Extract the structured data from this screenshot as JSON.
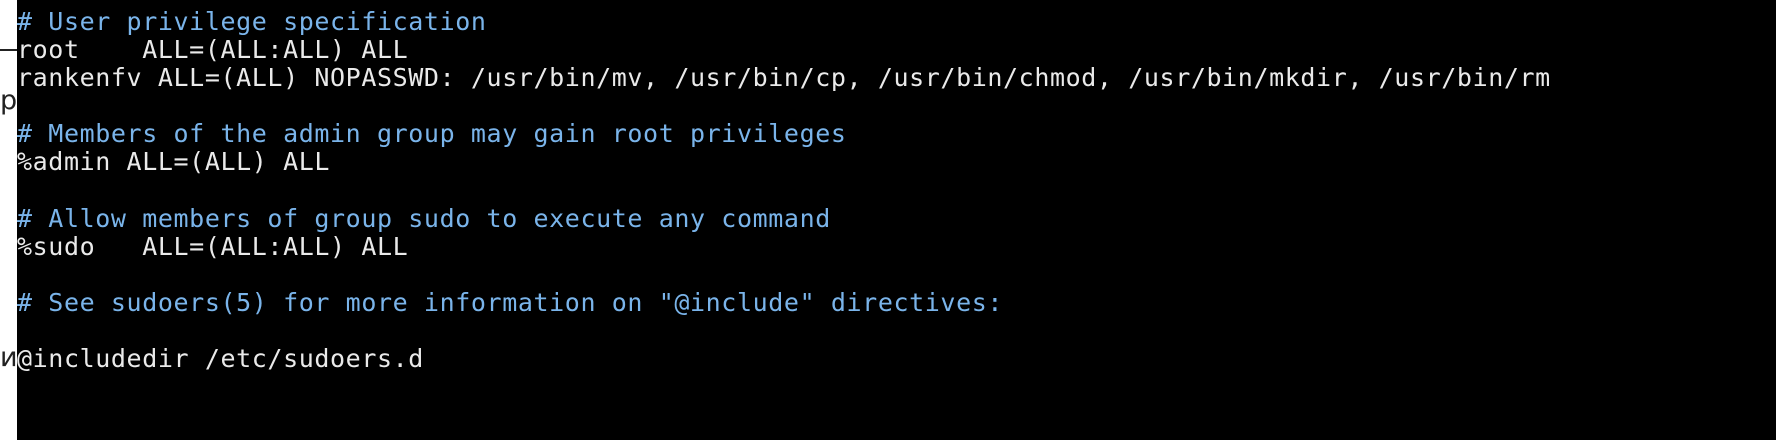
{
  "theme": {
    "background": "#000000",
    "comment_color": "#7ab4ea",
    "text_color": "#eaeaea"
  },
  "left_fragments": [
    "ре",
    "и"
  ],
  "lines": [
    {
      "type": "comment",
      "text": "# User privilege specification"
    },
    {
      "type": "code",
      "text": "root    ALL=(ALL:ALL) ALL"
    },
    {
      "type": "code",
      "text": "rankenfv ALL=(ALL) NOPASSWD: /usr/bin/mv, /usr/bin/cp, /usr/bin/chmod, /usr/bin/mkdir, /usr/bin/rm"
    },
    {
      "type": "comment",
      "text": "# Members of the admin group may gain root privileges"
    },
    {
      "type": "code",
      "text": "%admin ALL=(ALL) ALL"
    },
    {
      "type": "comment",
      "text": "# Allow members of group sudo to execute any command"
    },
    {
      "type": "code",
      "text": "%sudo   ALL=(ALL:ALL) ALL"
    },
    {
      "type": "comment",
      "text": "# See sudoers(5) for more information on \"@include\" directives:"
    },
    {
      "type": "code",
      "text": "@includedir /etc/sudoers.d"
    }
  ]
}
